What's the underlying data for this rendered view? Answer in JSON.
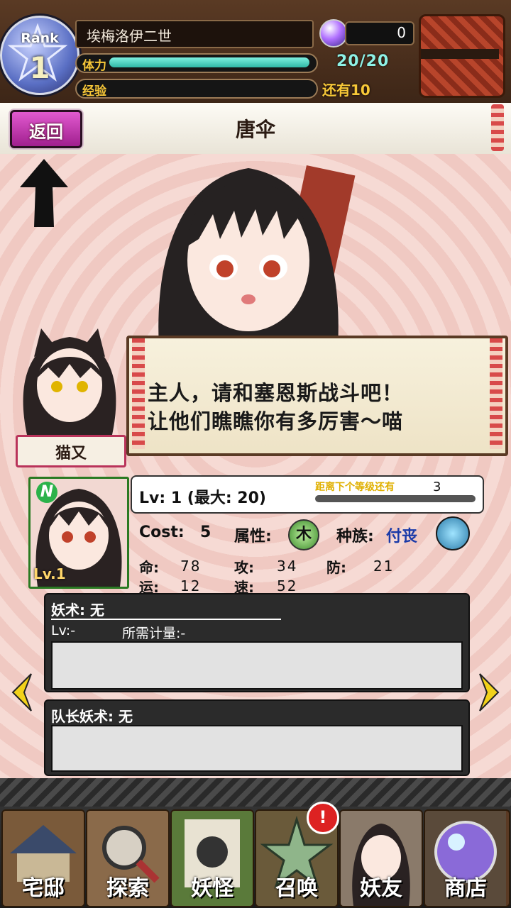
{
  "hud": {
    "rank_label": "Rank",
    "rank_value": "1",
    "player_name": "埃梅洛伊二世",
    "crystal_count": "0",
    "stamina_label": "体力",
    "stamina_value": "20/20",
    "stamina_fraction": 1.0,
    "exp_label": "经验",
    "exp_remaining": "还有10",
    "exp_fraction": 0.0,
    "icons": [
      "rank-star-icon",
      "orb-icon",
      "gift-box-icon"
    ]
  },
  "titlebar": {
    "back_label": "返回",
    "title": "唐伞"
  },
  "dialog": {
    "line1": "主人，请和塞恩斯战斗吧！",
    "line2": "让他们瞧瞧你有多厉害～喵",
    "speaker_name": "猫又"
  },
  "card": {
    "rarity": "N",
    "level_badge": "Lv.1",
    "level_text": "Lv:  1  (最大: 20)",
    "next_label": "距离下个等级还有",
    "next_value": "3",
    "cost_label": "Cost:",
    "cost_value": "5",
    "attr_label": "属性:",
    "attr_icon": "木",
    "race_label": "种族:",
    "race_value": "付丧",
    "stats": [
      {
        "key": "命:",
        "value": "78"
      },
      {
        "key": "攻:",
        "value": "34"
      },
      {
        "key": "防:",
        "value": "21"
      },
      {
        "key": "运:",
        "value": "12"
      },
      {
        "key": "速:",
        "value": "52"
      }
    ]
  },
  "skill": {
    "title": "妖术: 无",
    "lv": "Lv:-",
    "gauge": "所需计量:-"
  },
  "leader_skill": {
    "title": "队长妖术: 无"
  },
  "menu": {
    "items": [
      {
        "label": "宅邸",
        "icon": "mansion-icon"
      },
      {
        "label": "探索",
        "icon": "magnifier-icon"
      },
      {
        "label": "妖怪",
        "icon": "scroll-icon"
      },
      {
        "label": "召唤",
        "icon": "pentagram-icon"
      },
      {
        "label": "妖友",
        "icon": "friend-icon"
      },
      {
        "label": "商店",
        "icon": "shop-orb-icon"
      }
    ],
    "alert": "!"
  },
  "colors": {
    "accent_magenta": "#c238ae",
    "stamina": "#3cc7b4",
    "gold_text": "#f8c838"
  }
}
